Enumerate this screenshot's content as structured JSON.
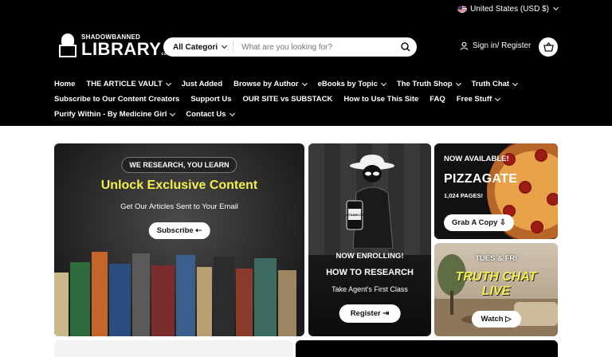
{
  "locale": {
    "label": "United States (USD $)"
  },
  "logo": {
    "top": "SHADOWBANNED",
    "main": "LIBRARY",
    "suffix": "com"
  },
  "search": {
    "category": "All Categori",
    "placeholder": "What are you looking for?"
  },
  "account": {
    "label": "Sign in/ Register"
  },
  "nav": {
    "row1": [
      {
        "label": "Home",
        "dropdown": false
      },
      {
        "label": "THE ARTICLE VAULT",
        "dropdown": true
      },
      {
        "label": "Just Added",
        "dropdown": false
      },
      {
        "label": "Browse by Author",
        "dropdown": true
      },
      {
        "label": "eBooks by Topic",
        "dropdown": true
      },
      {
        "label": "The Truth Shop",
        "dropdown": true
      },
      {
        "label": "Truth Chat",
        "dropdown": true
      }
    ],
    "row2": [
      {
        "label": "Subscribe to Our Content Creators",
        "dropdown": false
      },
      {
        "label": "Support Us",
        "dropdown": false
      },
      {
        "label": "OUR SITE vs SUBSTACK",
        "dropdown": false
      },
      {
        "label": "How to Use This Site",
        "dropdown": false
      },
      {
        "label": "FAQ",
        "dropdown": false
      },
      {
        "label": "Free Stuff",
        "dropdown": true
      }
    ],
    "row3": [
      {
        "label": "Purify Within - By Medicine Girl",
        "dropdown": true
      },
      {
        "label": "Contact Us",
        "dropdown": true
      }
    ]
  },
  "hero": {
    "tag": "WE RESEARCH, YOU LEARN",
    "title": "Unlock Exclusive Content",
    "subtitle": "Get Our Articles Sent to Your Email",
    "button": "Subscribe ⇠"
  },
  "course": {
    "enroll": "NOW ENROLLING!",
    "title": "HOW TO RESEARCH",
    "text": "Take Agent's First Class",
    "button": "Register ⇥",
    "bottle": "VITAMIN D3"
  },
  "pizzagate": {
    "now": "NOW AVAILABLE!",
    "title": "PIZZAGATE",
    "pages": "1,024 PAGES!",
    "button": "Grab A Copy ⇩"
  },
  "truthchat": {
    "days": "TUES & FRI",
    "title1": "TRUTH CHAT",
    "title2": "LIVE",
    "button": "Watch ▷"
  },
  "colors": {
    "accent_yellow": "#f4ef4a",
    "header_bg": "#000000"
  }
}
